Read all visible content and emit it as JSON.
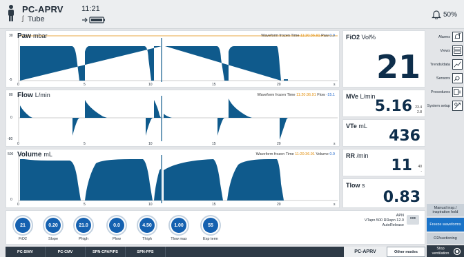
{
  "header": {
    "mode": "PC-APRV",
    "patient_interface": "Tube",
    "time": "11:21",
    "alarm_volume": "50%"
  },
  "waveforms": [
    {
      "title": "Paw",
      "unit": "mbar",
      "y_top": "30",
      "y_mid": "",
      "y_bot": "-5",
      "info_prefix": "Waveform frozen  Time",
      "info_time": "11:20:36.91",
      "info_param": "Paw",
      "info_value": "0.9"
    },
    {
      "title": "Flow",
      "unit": "L/min",
      "y_top": "80",
      "y_mid": "0",
      "y_bot": "-80",
      "info_prefix": "Waveform frozen  Time",
      "info_time": "11:20:36.91",
      "info_param": "Flow",
      "info_value": "-15.1"
    },
    {
      "title": "Volume",
      "unit": "mL",
      "y_top": "500",
      "y_mid": "",
      "y_bot": "0",
      "info_prefix": "Waveform frozen  Time",
      "info_time": "11:20:36.91",
      "info_param": "Volume",
      "info_value": "0.0"
    }
  ],
  "x_ticks": [
    "0",
    "5",
    "10",
    "15",
    "20",
    "s"
  ],
  "params": [
    {
      "name": "FiO2",
      "unit": "Vol%",
      "value": "21",
      "lim_hi": "",
      "lim_lo": ""
    },
    {
      "name": "MVe",
      "unit": "L/min",
      "value": "5.16",
      "lim_hi": "23.4",
      "lim_lo": "2.8"
    },
    {
      "name": "VTe",
      "unit": "mL",
      "value": "436",
      "lim_hi": "",
      "lim_lo": ""
    },
    {
      "name": "RR",
      "unit": "/min",
      "value": "11",
      "lim_hi": "40",
      "lim_lo": "-"
    },
    {
      "name": "Tlow",
      "unit": "s",
      "value": "0.83",
      "lim_hi": "",
      "lim_lo": ""
    }
  ],
  "sidebar": [
    {
      "label": "Alarms",
      "icon": "alarms-icon"
    },
    {
      "label": "Views",
      "icon": "views-icon"
    },
    {
      "label": "Trends/data",
      "icon": "trends-icon"
    },
    {
      "label": "Sensors",
      "icon": "sensors-icon"
    },
    {
      "label": "Procedures",
      "icon": "procedures-icon"
    },
    {
      "label": "System setup",
      "icon": "system-setup-icon"
    }
  ],
  "controls": [
    {
      "value": "21",
      "label": "FiO2"
    },
    {
      "value": "0.20",
      "label": "Slope"
    },
    {
      "value": "21.0",
      "label": "Phigh"
    },
    {
      "value": "0.0",
      "label": "Plow"
    },
    {
      "value": "4.50",
      "label": "Thigh"
    },
    {
      "value": "1.00",
      "label": "Tlow max"
    },
    {
      "value": "55",
      "label": "Exp term"
    }
  ],
  "apnea": {
    "title": "APN",
    "line1": "VTapn 500  RRapn 12.0",
    "line2": "AutoRelease",
    "more": "•••"
  },
  "right_buttons": {
    "manual": "Manual insp./ inspiration hold",
    "freeze": "Freeze waveforms",
    "o2": "O2/suctioning",
    "stop": "Stop ventilation"
  },
  "mode_tabs": [
    "PC-SIMV",
    "PC-CMV",
    "SPN-CPAP/PS",
    "SPN-PPS"
  ],
  "active_mode": "PC-APRV",
  "other_modes": "Other modes",
  "colors": {
    "wave": "#0f5a8c",
    "accent": "#1561b0",
    "freeze_line": "#e08a00"
  }
}
